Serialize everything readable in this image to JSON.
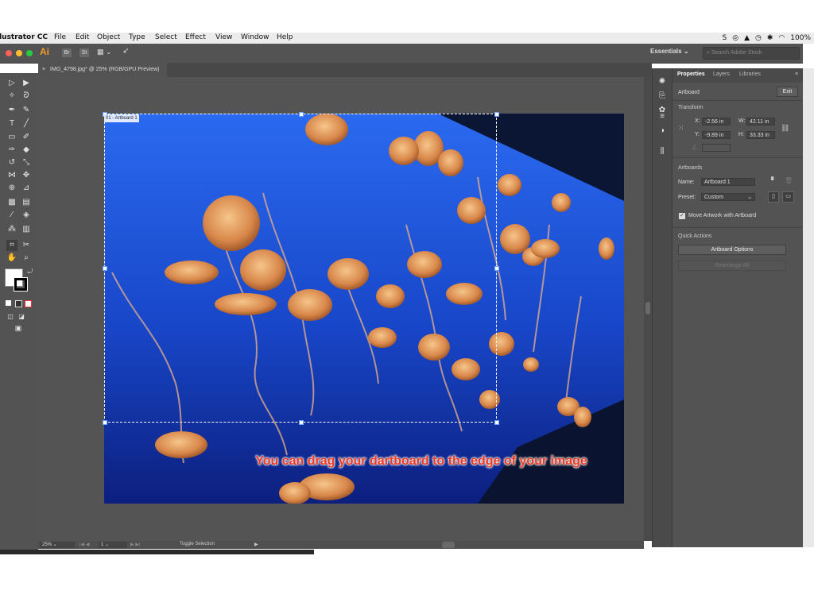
{
  "menubar": {
    "app_name": "llustrator CC",
    "items": [
      "File",
      "Edit",
      "Object",
      "Type",
      "Select",
      "Effect",
      "View",
      "Window",
      "Help"
    ],
    "battery": "100%"
  },
  "appbar": {
    "ai_logo": "Ai",
    "bridge": "Br",
    "stock": "St",
    "workspace": "Essentials",
    "search_placeholder": "Search Adobe Stock"
  },
  "document_tab": {
    "close": "×",
    "title": "IMG_4798.jpg* @ 25% (RGB/GPU Preview)"
  },
  "artboard": {
    "label": "01 - Artboard 1"
  },
  "caption": "You can drag your dartboard to the edge of your image",
  "statusbar": {
    "zoom": "25%",
    "artboard_num": "1",
    "mode": "Toggle Selection"
  },
  "panel": {
    "tabs": [
      "Properties",
      "Layers",
      "Libraries"
    ],
    "artboard_heading": "Artboard",
    "exit_button": "Exit",
    "transform_heading": "Transform",
    "x_label": "X:",
    "x_value": "-2.56 in",
    "y_label": "Y:",
    "y_value": "-9.89 in",
    "w_label": "W:",
    "w_value": "42.11 in",
    "h_label": "H:",
    "h_value": "33.33 in",
    "artboards_heading": "Artboards",
    "name_label": "Name:",
    "name_value": "Artboard 1",
    "preset_label": "Preset:",
    "preset_value": "Custom",
    "move_artwork_label": "Move Artwork with Artboard",
    "move_artwork_checked": true,
    "quick_actions_heading": "Quick Actions",
    "artboard_options_button": "Artboard Options",
    "rearrange_all_button": "Rearrange All"
  },
  "colors": {
    "accent_orange": "#f79a2a",
    "caption_red": "#ee3a23",
    "panel_bg": "#535353",
    "ocean_blue": "#1b4fc7"
  }
}
